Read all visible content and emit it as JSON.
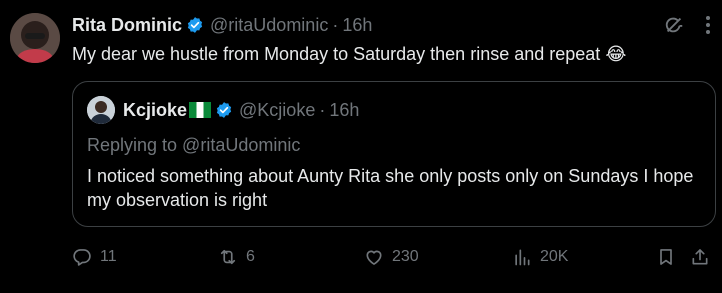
{
  "tweet": {
    "author_name": "Rita Dominic",
    "handle": "@ritaUdominic",
    "separator": "·",
    "time": "16h",
    "text": "My dear we hustle from Monday to Saturday then rinse and repeat",
    "emoji": "😂"
  },
  "quote": {
    "author_name": "Kcjioke",
    "handle": "@Kcjioke",
    "separator": "·",
    "time": "16h",
    "replying_to": "Replying to @ritaUdominic",
    "text": "I noticed something about Aunty Rita she only posts only on Sundays I hope my observation is right"
  },
  "actions": {
    "replies": "11",
    "reposts": "6",
    "likes": "230",
    "views": "20K"
  },
  "colors": {
    "background": "#000000",
    "primary_text": "#e7e9ea",
    "secondary_text": "#71767b",
    "verified_blue": "#1d9bf0",
    "border": "#3c4043"
  },
  "icons": {
    "verified": "verified-badge-icon",
    "grok": "grok-icon",
    "more": "more-icon",
    "reply": "reply-icon",
    "repost": "repost-icon",
    "like": "like-icon",
    "views": "views-icon",
    "bookmark": "bookmark-icon",
    "share": "share-icon",
    "flag": "nigeria-flag-icon"
  }
}
